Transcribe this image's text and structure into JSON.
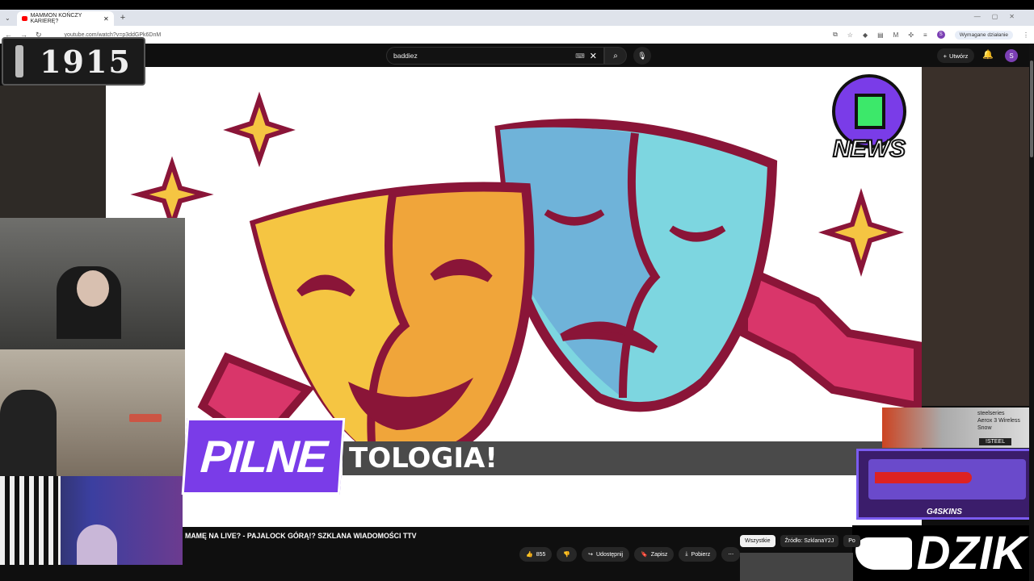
{
  "browser": {
    "tab_title": "MAMMON KOŃCZY KARIERĘ?",
    "new_tab": "+",
    "url": "youtube.com/watch?v=p3ddGPk6DnM",
    "required_action": "Wymagane działanie",
    "profile_initial": "S"
  },
  "youtube": {
    "search_value": "baddiez",
    "create_label": "Utwórz",
    "avatar_initial": "S",
    "video_title": "MAMĘ NA LIVE? - PAJALOCK GÓRĄ!? SZKLANA WIADOMOŚCI TTV",
    "like_count": "855",
    "share_label": "Udostępnij",
    "save_label": "Zapisz",
    "download_label": "Pobierz",
    "chips": [
      "Wszystkie",
      "Źródło: SzklanaY2J",
      "Po"
    ]
  },
  "overlays": {
    "logo_text": "1915",
    "pilne": "PILNE",
    "ticker": "TOLOGIA!",
    "news_logo": "NEWS",
    "steel_brand": "steelseries",
    "steel_product": "Aerox 3 Wireless",
    "steel_variant": "Snow",
    "steel_code": "!STEEL",
    "skins": "G4SKINS",
    "dzik": "DZIK"
  },
  "colors": {
    "mask_yellow": "#f5c542",
    "mask_orange": "#f0a53a",
    "mask_blue": "#6fb3d9",
    "mask_cyan": "#7dd6e0",
    "mask_outline": "#8a1538",
    "ribbon": "#d9366a",
    "pilne_purple": "#7a3ce8"
  }
}
